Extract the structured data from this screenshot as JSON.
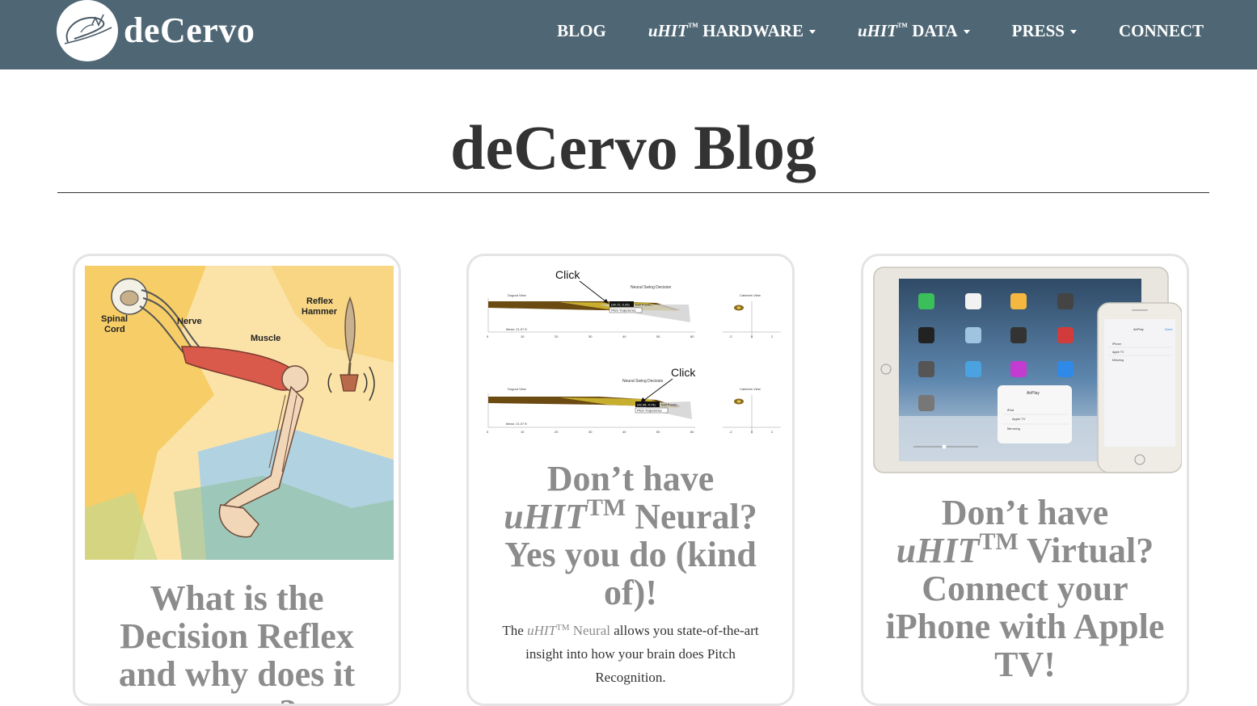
{
  "brand": {
    "name": "deCervo",
    "logo_icon": "signature-swoosh-logo-icon"
  },
  "nav": {
    "blog": "BLOG",
    "hardware_prefix": "uHIT",
    "hardware_tm": "™",
    "hardware_suffix": "HARDWARE",
    "data_prefix": "uHIT",
    "data_tm": "™",
    "data_suffix": "DATA",
    "press": "PRESS",
    "connect": "CONNECT"
  },
  "page": {
    "title": "deCervo Blog"
  },
  "posts": [
    {
      "title": "What is the Decision Reflex and why does it matter?",
      "image_labels": {
        "spinal_cord_1": "Spinal",
        "spinal_cord_2": "Cord",
        "nerve": "Nerve",
        "muscle": "Muscle",
        "reflex_hammer_1": "Reflex",
        "reflex_hammer_2": "Hammer"
      }
    },
    {
      "title_line1": "Don’t have",
      "title_italic": "uHIT",
      "title_tm": "TM",
      "title_after_tm": " Neural?",
      "title_line3": "Yes you do (kind of)!",
      "excerpt_before": "The ",
      "excerpt_italic": "uHIT",
      "excerpt_tm": "TM",
      "excerpt_muted": " Neural",
      "excerpt_after": " allows you state-of-the-art insight into how your brain does Pitch Recognition.",
      "image_labels": {
        "click_1": "Click",
        "click_2": "Click",
        "chart_title_1": "Neural Swing Decision",
        "chart_title_2": "Neural Swing Decision",
        "side_label_1": "Dugout View",
        "side_label_2": "Dugout View",
        "catcher_label_1": "Catchers View",
        "catcher_label_2": "Catchers View",
        "tooltip_1": "(34.72, 0.20)",
        "tooltip_2": "(42.45, 4.74)",
        "ball_pos_1": "Ball Positio...",
        "ball_pos_2": "Ball Positio...",
        "pitch_traj_1": "Pitch Trajectories",
        "pitch_traj_2": "Pitch Trajectories",
        "mean_1": "Mean: 21.07 ft",
        "mean_2": "Mean: 21.07 ft",
        "x_ticks": [
          "0",
          "10",
          "20",
          "30",
          "40",
          "50",
          "60"
        ],
        "catcher_ticks_1": [
          "-2",
          "0",
          "2"
        ],
        "catcher_ticks_2": [
          "-2",
          "0",
          "2"
        ]
      }
    },
    {
      "title_line1": "Don’t have",
      "title_italic": "uHIT",
      "title_tm": "TM",
      "title_after_tm": " Virtual?",
      "title_line3": "Connect your iPhone with Apple TV!",
      "image_labels": {
        "airplay": "AirPlay",
        "ipad": "iPad",
        "apple_tv": "Apple TV",
        "mirroring": "Mirroring",
        "iphone_airplay": "AirPlay",
        "iphone_done": "Done",
        "iphone_item1": "iPhone",
        "iphone_item2": "Apple TV",
        "iphone_item3": "Mirroring"
      }
    }
  ]
}
